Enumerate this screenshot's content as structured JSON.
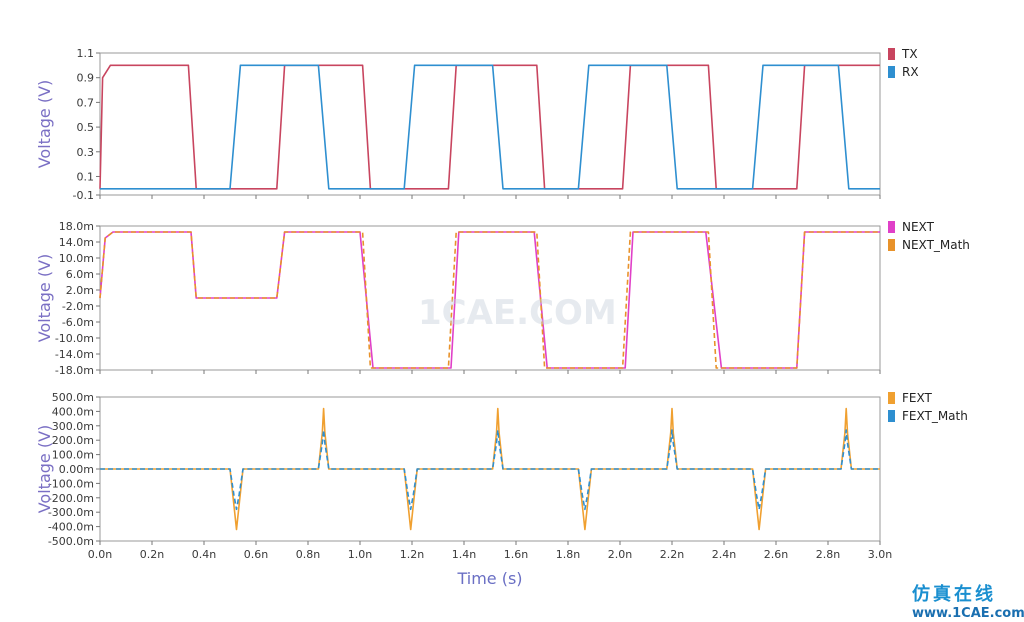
{
  "watermark": "1CAE.COM",
  "brand": {
    "cn": "仿真在线",
    "url": "www.1CAE.com"
  },
  "x_axis": {
    "label": "Time (s)",
    "ticks": [
      0,
      0.2,
      0.4,
      0.6,
      0.8,
      1.0,
      1.2,
      1.4,
      1.6,
      1.8,
      2.0,
      2.2,
      2.4,
      2.6,
      2.8,
      3.0
    ],
    "tick_labels": [
      "0.0n",
      "0.2n",
      "0.4n",
      "0.6n",
      "0.8n",
      "1.0n",
      "1.2n",
      "1.4n",
      "1.6n",
      "1.8n",
      "2.0n",
      "2.2n",
      "2.4n",
      "2.6n",
      "2.8n",
      "3.0n"
    ],
    "xlim": [
      0,
      3.0
    ]
  },
  "chart_data": [
    {
      "type": "line",
      "ylabel": "Voltage (V)",
      "ylim": [
        -0.05,
        1.1
      ],
      "yticks": [
        1.1,
        0.9,
        0.7,
        0.5,
        0.3,
        0.1,
        -0.1
      ],
      "ytick_labels": [
        "1.1",
        "0.9",
        "0.7",
        "0.5",
        "0.3",
        "0.1",
        "-0.1"
      ],
      "legend_position": "right",
      "series": [
        {
          "name": "TX",
          "color": "#c8455f",
          "x": [
            0,
            0.01,
            0.04,
            0.34,
            0.37,
            0.68,
            0.71,
            1.01,
            1.04,
            1.34,
            1.37,
            1.68,
            1.71,
            2.01,
            2.04,
            2.34,
            2.37,
            2.68,
            2.71,
            3.0
          ],
          "y": [
            0,
            0.9,
            1.0,
            1.0,
            0,
            0,
            1.0,
            1.0,
            0,
            0,
            1.0,
            1.0,
            0,
            0,
            1.0,
            1.0,
            0,
            0,
            1.0,
            1.0
          ]
        },
        {
          "name": "RX",
          "color": "#2e8fd0",
          "x": [
            0,
            0.5,
            0.54,
            0.84,
            0.88,
            1.17,
            1.21,
            1.51,
            1.55,
            1.84,
            1.88,
            2.18,
            2.22,
            2.51,
            2.55,
            2.84,
            2.88,
            3.0
          ],
          "y": [
            0,
            0,
            1.0,
            1.0,
            0,
            0,
            1.0,
            1.0,
            0,
            0,
            1.0,
            1.0,
            0,
            0,
            1.0,
            1.0,
            0,
            0
          ]
        }
      ]
    },
    {
      "type": "line",
      "ylabel": "Voltage (V)",
      "ylim": [
        -18.0,
        18.0
      ],
      "yticks": [
        18,
        14,
        10,
        6,
        2,
        -2,
        -6,
        -10,
        -14,
        -18
      ],
      "ytick_labels": [
        "18.0m",
        "14.0m",
        "10.0m",
        "6.0m",
        "2.0m",
        "-2.0m",
        "-6.0m",
        "-10.0m",
        "-14.0m",
        "-18.0m"
      ],
      "legend_position": "right",
      "series": [
        {
          "name": "NEXT",
          "color": "#e040c8",
          "x": [
            0,
            0.02,
            0.05,
            0.35,
            0.37,
            0.68,
            0.71,
            1.0,
            1.05,
            1.35,
            1.38,
            1.67,
            1.72,
            2.02,
            2.05,
            2.33,
            2.39,
            2.68,
            2.71,
            3.0
          ],
          "y": [
            0,
            15,
            16.5,
            16.5,
            0,
            0,
            16.5,
            16.5,
            -17.5,
            -17.5,
            16.5,
            16.5,
            -17.5,
            -17.5,
            16.5,
            16.5,
            -17.5,
            -17.5,
            16.5,
            16.5
          ]
        },
        {
          "name": "NEXT_Math",
          "color": "#e8922a",
          "x": [
            0,
            0.02,
            0.05,
            0.35,
            0.37,
            0.68,
            0.71,
            1.01,
            1.04,
            1.34,
            1.37,
            1.68,
            1.71,
            2.01,
            2.04,
            2.34,
            2.37,
            2.68,
            2.71,
            3.0
          ],
          "y": [
            0,
            15,
            16.5,
            16.5,
            0,
            0,
            16.5,
            16.5,
            -17.5,
            -17.5,
            16.5,
            16.5,
            -17.5,
            -17.5,
            16.5,
            16.5,
            -17.5,
            -17.5,
            16.5,
            16.5
          ]
        }
      ]
    },
    {
      "type": "line",
      "ylabel": "Voltage (V)",
      "ylim": [
        -500,
        500
      ],
      "yticks": [
        500,
        400,
        300,
        200,
        100,
        0,
        -100,
        -200,
        -300,
        -400,
        -500
      ],
      "ytick_labels": [
        "500.0m",
        "400.0m",
        "300.0m",
        "200.0m",
        "100.0m",
        "0.00m",
        "-100.0m",
        "-200.0m",
        "-300.0m",
        "-400.0m",
        "-500.0m"
      ],
      "legend_position": "right",
      "series": [
        {
          "name": "FEXT",
          "color": "#f0a030",
          "x": [
            0,
            0.5,
            0.515,
            0.525,
            0.535,
            0.55,
            0.84,
            0.855,
            0.86,
            0.865,
            0.88,
            1.17,
            1.185,
            1.195,
            1.205,
            1.22,
            1.51,
            1.525,
            1.53,
            1.535,
            1.55,
            1.84,
            1.855,
            1.865,
            1.875,
            1.89,
            2.18,
            2.195,
            2.2,
            2.205,
            2.22,
            2.51,
            2.525,
            2.535,
            2.545,
            2.56,
            2.85,
            2.865,
            2.87,
            2.875,
            2.89,
            3.0
          ],
          "y": [
            0,
            0,
            -250,
            -420,
            -250,
            0,
            0,
            250,
            420,
            250,
            0,
            0,
            -250,
            -420,
            -250,
            0,
            0,
            250,
            420,
            250,
            0,
            0,
            -250,
            -420,
            -250,
            0,
            0,
            250,
            420,
            250,
            0,
            0,
            -250,
            -420,
            -250,
            0,
            0,
            250,
            420,
            250,
            0,
            0
          ]
        },
        {
          "name": "FEXT_Math",
          "color": "#2e8fd0",
          "x": [
            0,
            0.5,
            0.515,
            0.525,
            0.535,
            0.55,
            0.84,
            0.855,
            0.86,
            0.865,
            0.88,
            1.17,
            1.185,
            1.195,
            1.205,
            1.22,
            1.51,
            1.525,
            1.53,
            1.535,
            1.55,
            1.84,
            1.855,
            1.865,
            1.875,
            1.89,
            2.18,
            2.195,
            2.2,
            2.205,
            2.22,
            2.51,
            2.525,
            2.535,
            2.545,
            2.56,
            2.85,
            2.865,
            2.87,
            2.875,
            2.89,
            3.0
          ],
          "y": [
            0,
            0,
            -180,
            -280,
            -180,
            0,
            0,
            180,
            270,
            180,
            0,
            0,
            -180,
            -280,
            -180,
            0,
            0,
            180,
            270,
            180,
            0,
            0,
            -180,
            -280,
            -180,
            0,
            0,
            180,
            270,
            180,
            0,
            0,
            -180,
            -280,
            -180,
            0,
            0,
            180,
            270,
            180,
            0,
            0
          ]
        }
      ]
    }
  ]
}
